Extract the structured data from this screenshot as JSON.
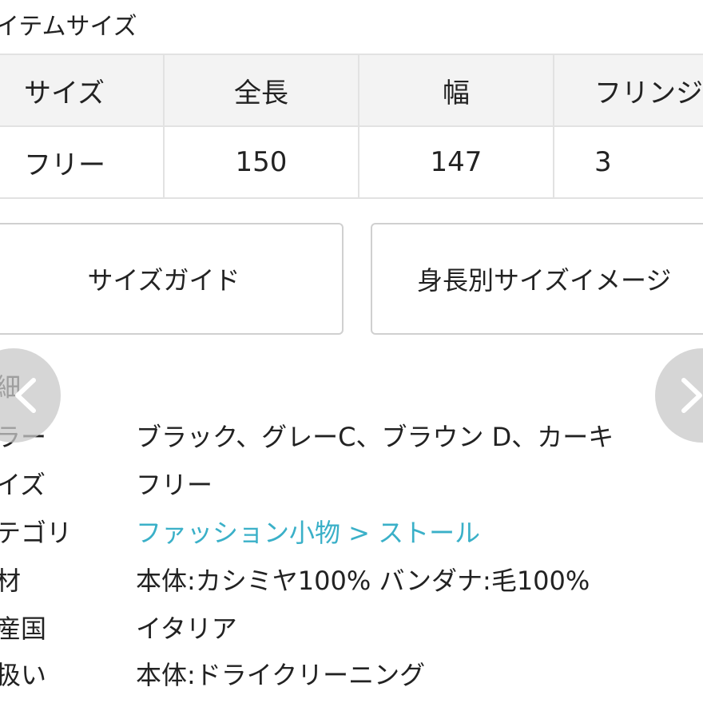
{
  "section_title": "イテムサイズ",
  "size_table": {
    "headers": [
      "サイズ",
      "全長",
      "幅",
      "フリンジ"
    ],
    "rows": [
      [
        "フリー",
        "150",
        "147",
        "3"
      ]
    ]
  },
  "buttons": {
    "size_guide": "サイズガイド",
    "height_size_image": "身長別サイズイメージ"
  },
  "nav": {
    "prev_icon": "chevron-left-icon",
    "next_icon": "chevron-right-icon"
  },
  "details": {
    "heading": "細",
    "rows": [
      {
        "label": "ラー",
        "value": "ブラック、グレーC、ブラウン D、カーキ"
      },
      {
        "label": "イズ",
        "value": "フリー"
      },
      {
        "label": "テゴリ",
        "value": "ファッション小物 > ストール",
        "is_link": true
      },
      {
        "label": "材",
        "value": "本体:カシミヤ100% バンダナ:毛100%"
      },
      {
        "label": "産国",
        "value": "イタリア"
      },
      {
        "label": "扱い",
        "value": "本体:ドライクリーニング"
      }
    ]
  },
  "colors": {
    "link": "#3ab0c8",
    "table_header_bg": "#f3f3f3",
    "border": "#e2e2e2",
    "nav_circle": "#c8c8c8"
  }
}
